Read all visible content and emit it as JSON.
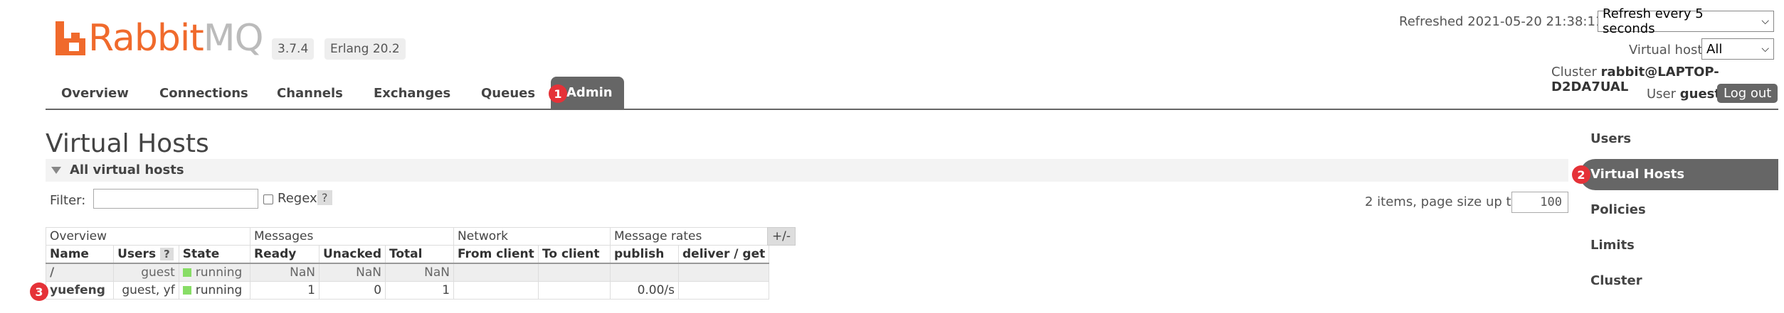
{
  "header": {
    "logo_text_rabbit": "Rabbit",
    "logo_text_mq": "MQ",
    "version": "3.7.4",
    "erlang": "Erlang 20.2",
    "refreshed": "Refreshed 2021-05-20 21:38:11",
    "refresh_select": "Refresh every 5 seconds",
    "vhost_label": "Virtual host",
    "vhost_select": "All",
    "cluster_label": "Cluster",
    "cluster_value": "rabbit@LAPTOP-D2DA7UAL",
    "user_label": "User",
    "user_value": "guest",
    "logout": "Log out"
  },
  "nav": {
    "overview": "Overview",
    "connections": "Connections",
    "channels": "Channels",
    "exchanges": "Exchanges",
    "queues": "Queues",
    "admin": "Admin"
  },
  "badges": {
    "b1": "1",
    "b2": "2",
    "b3": "3"
  },
  "page": {
    "title": "Virtual Hosts",
    "section_title": "All virtual hosts",
    "filter_label": "Filter:",
    "regex_label": "Regex",
    "help": "?",
    "items_text": "2 items, page size up to",
    "page_size": "100",
    "plusminus": "+/-"
  },
  "table": {
    "groups": {
      "overview": "Overview",
      "messages": "Messages",
      "network": "Network",
      "rates": "Message rates"
    },
    "columns": {
      "name": "Name",
      "users": "Users",
      "users_help": "?",
      "state": "State",
      "ready": "Ready",
      "unacked": "Unacked",
      "total": "Total",
      "from_client": "From client",
      "to_client": "To client",
      "publish": "publish",
      "deliver_get": "deliver / get"
    },
    "rows": [
      {
        "name": "/",
        "users": "guest",
        "state": "running",
        "ready": "NaN",
        "unacked": "NaN",
        "total": "NaN",
        "from_client": "",
        "to_client": "",
        "publish": "",
        "deliver_get": ""
      },
      {
        "name": "yuefeng",
        "users": "guest, yf",
        "state": "running",
        "ready": "1",
        "unacked": "0",
        "total": "1",
        "from_client": "",
        "to_client": "",
        "publish": "0.00/s",
        "deliver_get": ""
      }
    ]
  },
  "sidebar": {
    "users": "Users",
    "virtual_hosts": "Virtual Hosts",
    "policies": "Policies",
    "limits": "Limits",
    "cluster": "Cluster"
  },
  "colors": {
    "brand_orange": "#f06a2c",
    "nav_active": "#666666",
    "badge_red": "#e53238",
    "running_green": "#88dd66"
  }
}
